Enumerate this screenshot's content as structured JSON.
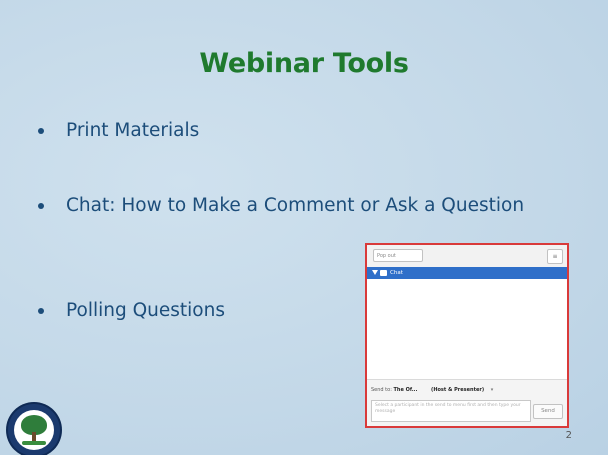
{
  "slide": {
    "title": "Webinar Tools",
    "bullets": [
      "Print Materials",
      "Chat:  How to Make a Comment or Ask a Question",
      "Polling Questions"
    ],
    "page_number": "2"
  },
  "chat_panel": {
    "popout_label": "Pop out",
    "menu_icon": "menu-icon",
    "section_label": "Chat",
    "send_to_label": "Send to:",
    "recipient_primary": "The Of...",
    "recipient_secondary": "(Host & Presenter)",
    "input_placeholder": "Select a participant in the send to menu first and then type your message",
    "send_button": "Send"
  },
  "colors": {
    "title": "#1f7a2e",
    "bullet_text": "#1c4d7a",
    "highlight_border": "#d93a3a",
    "chat_bar": "#2f6fc9"
  }
}
